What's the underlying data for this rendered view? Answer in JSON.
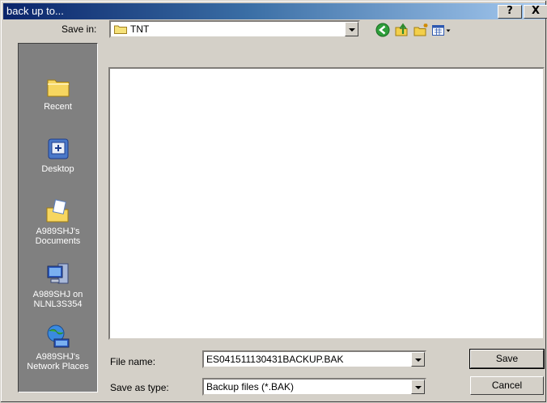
{
  "window": {
    "title": "back up to...",
    "help_label": "?",
    "close_label": "X"
  },
  "toolbar": {
    "save_in_label": "Save in:",
    "save_in_value": "TNT",
    "icons": [
      "back-icon",
      "up-folder-icon",
      "new-folder-icon",
      "view-menu-icon"
    ]
  },
  "places": [
    {
      "label": "Recent",
      "icon": "recent-folder-icon"
    },
    {
      "label": "Desktop",
      "icon": "desktop-icon"
    },
    {
      "label": "A989SHJ's Documents",
      "icon": "my-documents-icon"
    },
    {
      "label": "A989SHJ on NLNL3S354",
      "icon": "my-computer-icon"
    },
    {
      "label": "A989SHJ's Network Places",
      "icon": "network-places-icon"
    }
  ],
  "footer": {
    "file_name_label": "File name:",
    "file_name_value": "ES041511130431BACKUP.BAK",
    "save_as_type_label": "Save as type:",
    "save_as_type_value": "Backup files (*.BAK)",
    "save_button": "Save",
    "cancel_button": "Cancel"
  },
  "colors": {
    "title_start": "#0a246a",
    "title_end": "#a6caf0",
    "face": "#d4d0c8",
    "places_bg": "#808080"
  }
}
